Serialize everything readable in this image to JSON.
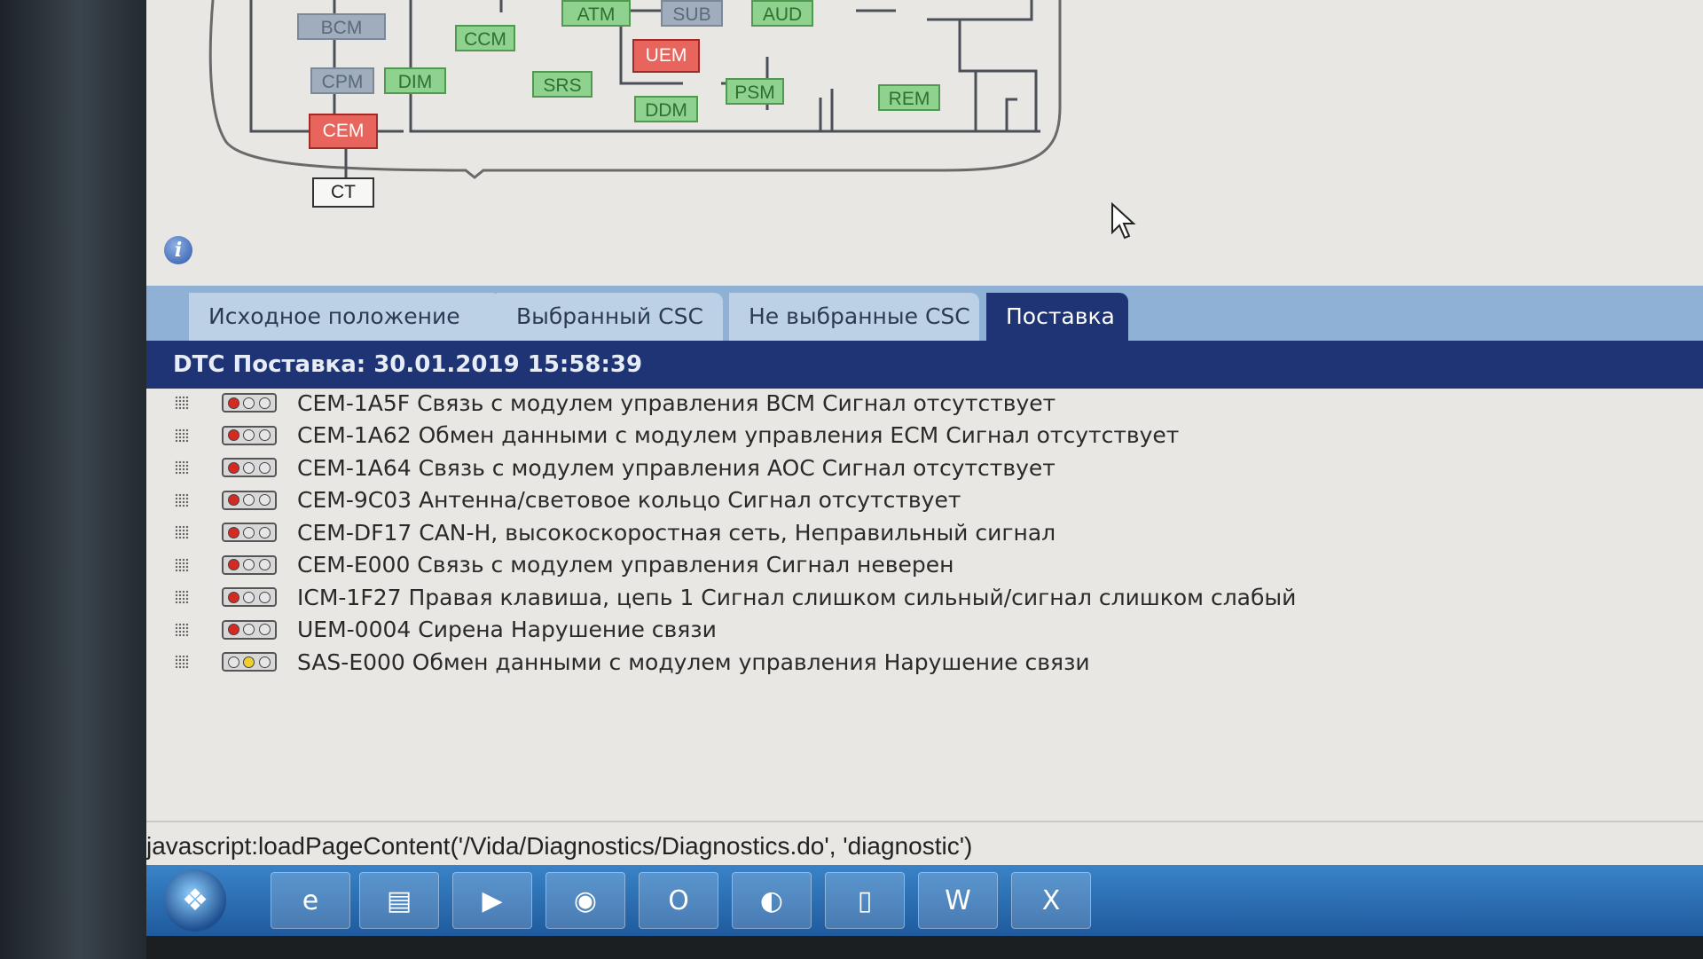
{
  "diagram": {
    "nodes": [
      {
        "id": "bcm",
        "label": "BCM",
        "style": "grey"
      },
      {
        "id": "atm",
        "label": "ATM",
        "style": "green"
      },
      {
        "id": "sub",
        "label": "SUB",
        "style": "grey"
      },
      {
        "id": "aud",
        "label": "AUD",
        "style": "green"
      },
      {
        "id": "ccm",
        "label": "CCM",
        "style": "green"
      },
      {
        "id": "uem",
        "label": "UEM",
        "style": "red"
      },
      {
        "id": "cpm",
        "label": "CPM",
        "style": "grey"
      },
      {
        "id": "dim",
        "label": "DIM",
        "style": "green"
      },
      {
        "id": "srs",
        "label": "SRS",
        "style": "green"
      },
      {
        "id": "psm",
        "label": "PSM",
        "style": "green"
      },
      {
        "id": "rem",
        "label": "REM",
        "style": "green"
      },
      {
        "id": "ddm",
        "label": "DDM",
        "style": "green"
      },
      {
        "id": "cem",
        "label": "CEM",
        "style": "red"
      },
      {
        "id": "ct",
        "label": "CT",
        "style": "white"
      }
    ]
  },
  "tabs": [
    {
      "label": "Исходное положение",
      "active": false
    },
    {
      "label": "Выбранный CSC",
      "active": false
    },
    {
      "label": "Не выбранные CSC",
      "active": false
    },
    {
      "label": "Поставка",
      "active": true
    }
  ],
  "dtc_header": "DTC Поставка: 30.01.2019 15:58:39",
  "dtc_list": [
    {
      "text": "CEM-1A5F Связь с модулем управления BCM Сигнал отсутствует",
      "status": "red"
    },
    {
      "text": "CEM-1A62 Обмен данными с модулем управления ECM Сигнал отсутствует",
      "status": "red"
    },
    {
      "text": "CEM-1A64 Связь с модулем управления AOC Сигнал отсутствует",
      "status": "red"
    },
    {
      "text": "CEM-9C03 Антенна/световое кольцо Сигнал отсутствует",
      "status": "red"
    },
    {
      "text": "CEM-DF17 CAN-H, высокоскоростная сеть, Неправильный сигнал",
      "status": "red"
    },
    {
      "text": "CEM-E000 Связь с модулем управления Сигнал неверен",
      "status": "red"
    },
    {
      "text": "ICM-1F27 Правая клавиша, цепь 1 Сигнал слишком сильный/сигнал слишком слабый",
      "status": "red"
    },
    {
      "text": "UEM-0004 Сирена Нарушение связи",
      "status": "red"
    },
    {
      "text": "SAS-E000 Обмен данными с модулем управления Нарушение связи",
      "status": "yellow"
    }
  ],
  "status_bar": "javascript:loadPageContent('/Vida/Diagnostics/Diagnostics.do', 'diagnostic')",
  "taskbar": {
    "start_glyph": "❖",
    "apps": [
      {
        "name": "internet-explorer-icon",
        "glyph": "e"
      },
      {
        "name": "file-explorer-icon",
        "glyph": "▤"
      },
      {
        "name": "media-player-icon",
        "glyph": "▶"
      },
      {
        "name": "chrome-icon",
        "glyph": "◉"
      },
      {
        "name": "outlook-icon",
        "glyph": "O"
      },
      {
        "name": "firefox-icon",
        "glyph": "◐"
      },
      {
        "name": "notepad-icon",
        "glyph": "▯"
      },
      {
        "name": "word-icon",
        "glyph": "W"
      },
      {
        "name": "excel-icon",
        "glyph": "X"
      }
    ]
  }
}
